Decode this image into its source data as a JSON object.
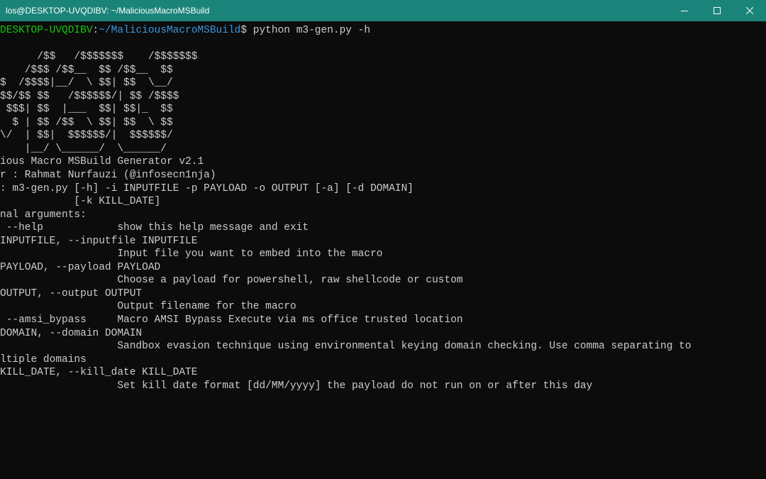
{
  "window": {
    "title": "los@DESKTOP-UVQDIBV: ~/MaliciousMacroMSBuild"
  },
  "prompt": {
    "user_host": "DESKTOP-UVQDIBV",
    "sep1": ":",
    "path": "~/MaliciousMacroMSBuild",
    "sep2": "$",
    "command": " python m3-gen.py -h"
  },
  "banner": [
    "      /$$   /$$$$$$$    /$$$$$$$",
    "    /$$$ /$$__  $$ /$$__  $$",
    "$  /$$$$|__/  \\ $$| $$  \\__/",
    "$$/$$ $$   /$$$$$$/| $$ /$$$$",
    " $$$| $$  |___  $$| $$|_  $$",
    "  $ | $$ /$$  \\ $$| $$  \\ $$",
    "\\/  | $$|  $$$$$$/|  $$$$$$/",
    "    |__/ \\______/  \\______/"
  ],
  "header": [
    "",
    "ious Macro MSBuild Generator v2.1",
    "r : Rahmat Nurfauzi (@infosecn1nja)",
    "",
    ": m3-gen.py [-h] -i INPUTFILE -p PAYLOAD -o OUTPUT [-a] [-d DOMAIN]",
    "            [-k KILL_DATE]",
    "",
    "nal arguments:",
    " --help            show this help message and exit",
    "INPUTFILE, --inputfile INPUTFILE",
    "                   Input file you want to embed into the macro",
    "PAYLOAD, --payload PAYLOAD",
    "                   Choose a payload for powershell, raw shellcode or custom",
    "OUTPUT, --output OUTPUT",
    "                   Output filename for the macro",
    " --amsi_bypass     Macro AMSI Bypass Execute via ms office trusted location",
    "DOMAIN, --domain DOMAIN",
    "                   Sandbox evasion technique using environmental keying domain checking. Use comma separating to",
    "ltiple domains",
    "KILL_DATE, --kill_date KILL_DATE",
    "                   Set kill date format [dd/MM/yyyy] the payload do not run on or after this day"
  ]
}
